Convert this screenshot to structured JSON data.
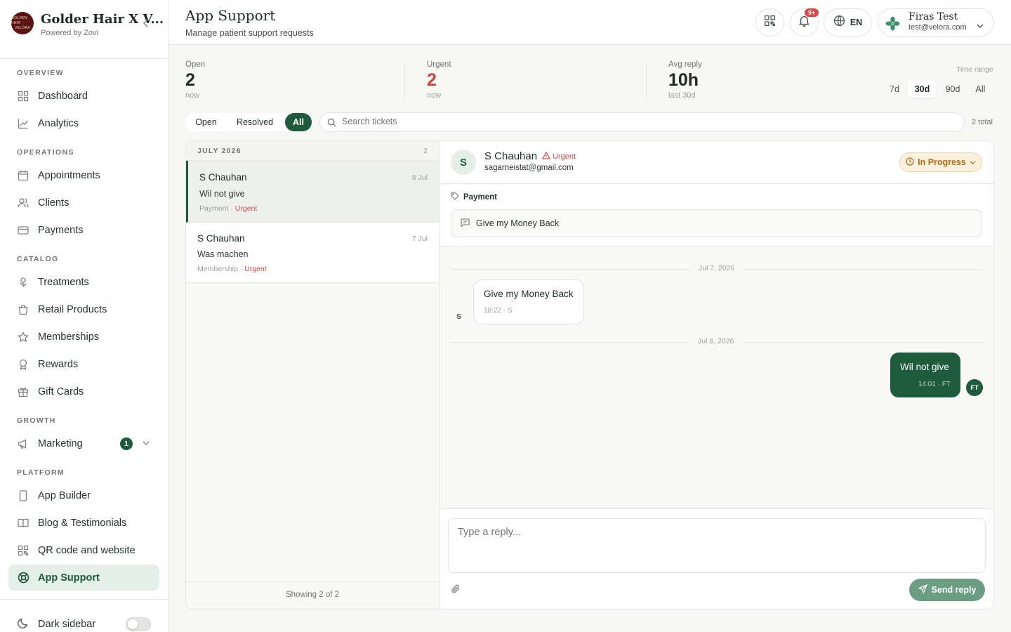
{
  "brand": {
    "logo_line1": "GOLDEN HAIR",
    "logo_line2": "VELORA",
    "name": "Golder Hair X V...",
    "sub": "Powered by Zovi"
  },
  "sidebar": {
    "sections": {
      "overview": "OVERVIEW",
      "operations": "OPERATIONS",
      "catalog": "CATALOG",
      "growth": "GROWTH",
      "platform": "PLATFORM"
    },
    "items": [
      {
        "label": "Dashboard",
        "icon": "grid-icon"
      },
      {
        "label": "Analytics",
        "icon": "chart-icon"
      },
      {
        "label": "Appointments",
        "icon": "calendar-icon"
      },
      {
        "label": "Clients",
        "icon": "users-icon"
      },
      {
        "label": "Payments",
        "icon": "card-icon"
      },
      {
        "label": "Treatments",
        "icon": "flower-icon"
      },
      {
        "label": "Retail Products",
        "icon": "bag-icon"
      },
      {
        "label": "Memberships",
        "icon": "star-icon"
      },
      {
        "label": "Rewards",
        "icon": "award-icon"
      },
      {
        "label": "Gift Cards",
        "icon": "gift-icon"
      },
      {
        "label": "Marketing",
        "icon": "megaphone-icon",
        "badge": "1"
      },
      {
        "label": "App Builder",
        "icon": "phone-icon"
      },
      {
        "label": "Blog & Testimonials",
        "icon": "book-icon"
      },
      {
        "label": "QR code and website",
        "icon": "qr-icon"
      },
      {
        "label": "App Support",
        "icon": "lifebuoy-icon"
      }
    ],
    "dark_label": "Dark sidebar"
  },
  "header": {
    "title": "App Support",
    "subtitle": "Manage patient support requests",
    "notif_count": "9+",
    "lang": "EN",
    "user_name": "Firas Test",
    "user_email": "test@velora.com"
  },
  "stats": {
    "open": {
      "label": "Open",
      "value": "2",
      "sub": "now"
    },
    "urgent": {
      "label": "Urgent",
      "value": "2",
      "sub": "now"
    },
    "avg": {
      "label": "Avg reply",
      "value": "10h",
      "sub": "last 30d"
    }
  },
  "time_range": {
    "label": "Time range",
    "options": [
      "7d",
      "30d",
      "90d",
      "All"
    ],
    "selected": "30d"
  },
  "filters": {
    "options": [
      "Open",
      "Resolved",
      "All"
    ],
    "selected": "All"
  },
  "search": {
    "placeholder": "Search tickets"
  },
  "total_text": "2 total",
  "list": {
    "month": "JULY 2026",
    "count": "2",
    "tickets": [
      {
        "name": "S Chauhan",
        "date": "8 Jul",
        "subject": "Wil not give",
        "category": "Payment",
        "priority": "Urgent"
      },
      {
        "name": "S Chauhan",
        "date": "7 Jul",
        "subject": "Was machen",
        "category": "Membership",
        "priority": "Urgent"
      }
    ],
    "footer": "Showing 2 of 2"
  },
  "detail": {
    "avatar": "S",
    "name": "S Chauhan",
    "priority": "Urgent",
    "email": "sagarneistat@gmail.com",
    "status": "In Progress",
    "category": "Payment",
    "subject": "Give my Money Back",
    "messages": [
      {
        "date": "Jul 7, 2026",
        "text": "Give my Money Back",
        "meta": "18:22 · S",
        "sender": "S",
        "incoming": true
      },
      {
        "date": "Jul 8, 2026",
        "text": "Wil not give",
        "meta": "14:01 · FT",
        "sender": "FT",
        "incoming": false
      }
    ],
    "reply_placeholder": "Type a reply...",
    "send_label": "Send reply"
  },
  "colors": {
    "brand": "#1e5a3c",
    "urgent": "#d94646",
    "status": "#b36b12"
  }
}
